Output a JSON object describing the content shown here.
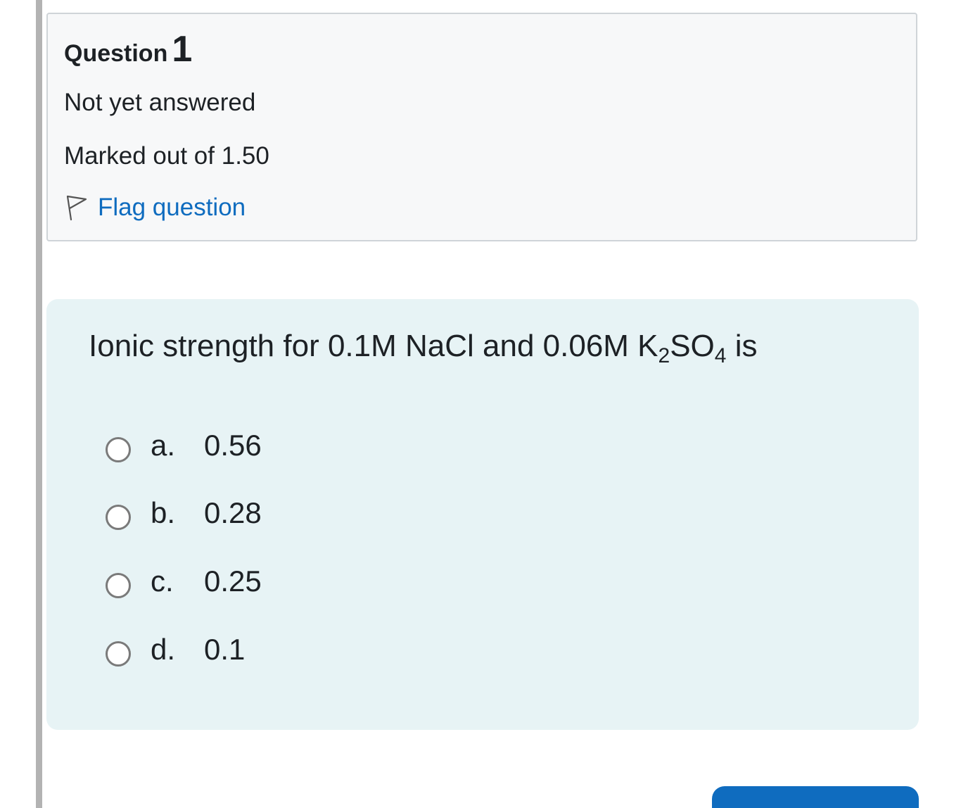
{
  "question_info": {
    "label": "Question",
    "number": "1",
    "state": "Not yet answered",
    "grade": "Marked out of 1.50",
    "flag_label": "Flag question",
    "flag_icon": "flag-icon"
  },
  "question": {
    "text_prefix": "Ionic strength for 0.1M NaCl and 0.06M K",
    "sub1": "2",
    "text_mid": "SO",
    "sub2": "4",
    "text_suffix": " is",
    "options": [
      {
        "letter": "a.",
        "value": "0.56",
        "checked": false
      },
      {
        "letter": "b.",
        "value": "0.28",
        "checked": false
      },
      {
        "letter": "c.",
        "value": "0.25",
        "checked": false
      },
      {
        "letter": "d.",
        "value": "0.1",
        "checked": false
      }
    ]
  },
  "colors": {
    "link": "#0f6cbf",
    "formulation_bg": "#e7f3f5",
    "info_bg": "#f7f8f9",
    "primary_button": "#0f6cbf"
  }
}
